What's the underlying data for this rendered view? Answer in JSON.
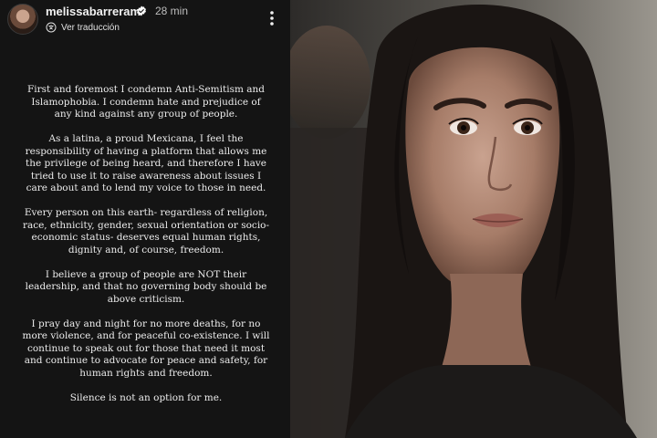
{
  "header": {
    "username": "melissabarreram",
    "time": "28 min",
    "translate_label": "Ver traducción"
  },
  "story": {
    "paragraphs": [
      "First and foremost I condemn Anti-Semitism and Islamophobia. I condemn hate and prejudice of any kind against any group of people.",
      "As a latina, a proud Mexicana, I feel the responsibility of having a platform that allows me the privilege of being heard, and therefore I have tried to use it to raise awareness about issues I care about and to lend my voice to those in need.",
      "Every person on this earth- regardless of religion, race, ethnicity, gender, sexual orientation or socio-economic status- deserves equal human rights, dignity and, of course, freedom.",
      "I believe a group of people are NOT their leadership, and that no governing body should be above criticism.",
      "I pray day and night for no more deaths, for no more violence, and for peaceful co-existence. I will continue to speak out for those that need it most and continue to advocate for peace and safety, for human rights and freedom.",
      "Silence is not an option for me."
    ]
  },
  "icons": {
    "verified": "verified-badge-icon",
    "translate": "translate-icon",
    "more": "more-options-icon"
  },
  "colors": {
    "story_bg": "#141414",
    "text": "#ececec",
    "verified": "#ffffff"
  }
}
